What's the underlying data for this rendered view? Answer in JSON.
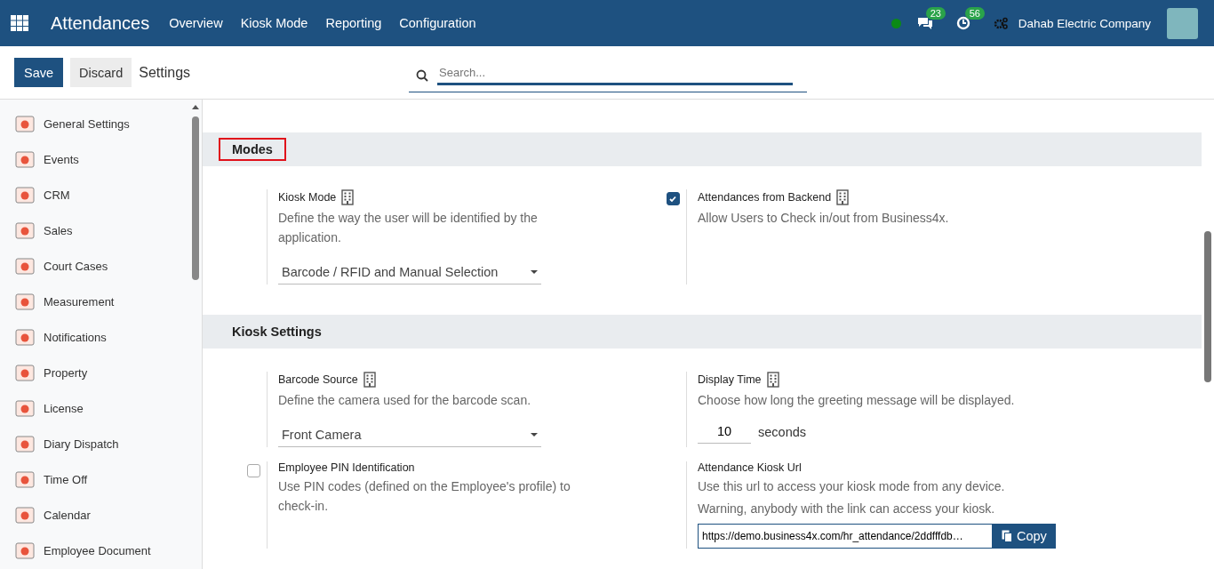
{
  "navbar": {
    "app_title": "Attendances",
    "menu": [
      {
        "label": "Overview"
      },
      {
        "label": "Kiosk Mode"
      },
      {
        "label": "Reporting"
      },
      {
        "label": "Configuration"
      }
    ],
    "messages_count": "23",
    "activities_count": "56",
    "company": "Dahab Electric Company"
  },
  "control_panel": {
    "save": "Save",
    "discard": "Discard",
    "breadcrumb": "Settings",
    "search": {
      "placeholder": "Search..."
    }
  },
  "sidebar": {
    "items": [
      {
        "label": "General Settings"
      },
      {
        "label": "Events"
      },
      {
        "label": "CRM"
      },
      {
        "label": "Sales"
      },
      {
        "label": "Court Cases"
      },
      {
        "label": "Measurement"
      },
      {
        "label": "Notifications"
      },
      {
        "label": "Property"
      },
      {
        "label": "License"
      },
      {
        "label": "Diary Dispatch"
      },
      {
        "label": "Time Off"
      },
      {
        "label": "Calendar"
      },
      {
        "label": "Employee Document"
      }
    ]
  },
  "sections": [
    {
      "title": "Modes",
      "highlighted": true,
      "settings": [
        {
          "kind": "select",
          "title": "Kiosk Mode",
          "company_specific": true,
          "description": "Define the way the user will be identified by the application.",
          "value": "Barcode / RFID and Manual Selection"
        },
        {
          "kind": "checkbox",
          "checked": true,
          "title": "Attendances from Backend",
          "company_specific": true,
          "description": "Allow Users to Check in/out from Business4x."
        }
      ]
    },
    {
      "title": "Kiosk Settings",
      "highlighted": false,
      "settings": [
        {
          "kind": "select",
          "title": "Barcode Source",
          "company_specific": true,
          "description": "Define the camera used for the barcode scan.",
          "value": "Front Camera"
        },
        {
          "kind": "number",
          "title": "Display Time",
          "company_specific": true,
          "description": "Choose how long the greeting message will be displayed.",
          "value": "10",
          "unit": "seconds"
        },
        {
          "kind": "checkbox",
          "checked": false,
          "title": "Employee PIN Identification",
          "company_specific": false,
          "description": "Use PIN codes (defined on the Employee's profile) to check-in."
        },
        {
          "kind": "url",
          "title": "Attendance Kiosk Url",
          "company_specific": false,
          "description": "Use this url to access your kiosk mode from any device.",
          "warning": "Warning, anybody with the link can access your kiosk.",
          "url": "https://demo.business4x.com/hr_attendance/2ddfffdb…",
          "button": "Copy"
        }
      ]
    }
  ]
}
